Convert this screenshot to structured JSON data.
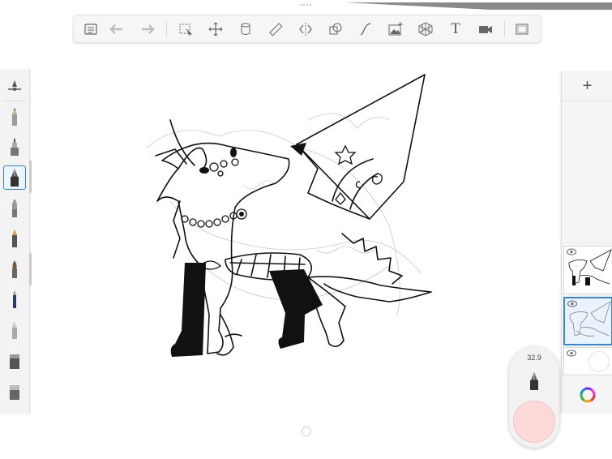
{
  "toolbar": {
    "tools": [
      {
        "name": "layers-list-icon"
      },
      {
        "name": "undo-icon"
      },
      {
        "name": "redo-icon"
      },
      {
        "name": "selection-icon"
      },
      {
        "name": "transform-icon"
      },
      {
        "name": "fill-icon"
      },
      {
        "name": "ruler-icon"
      },
      {
        "name": "symmetry-icon"
      },
      {
        "name": "shapes-icon"
      },
      {
        "name": "curve-icon"
      },
      {
        "name": "import-image-icon"
      },
      {
        "name": "perspective-icon"
      },
      {
        "name": "text-icon"
      },
      {
        "name": "record-icon"
      },
      {
        "name": "fullscreen-icon"
      }
    ],
    "text_tool_label": "T"
  },
  "brushes": [
    "brush-settings-icon",
    "pencil-icon",
    "airbrush-icon",
    "inking-pen-icon",
    "marker-icon",
    "fountain-pen-icon",
    "paintbrush-icon",
    "ballpoint-pen-icon",
    "chisel-icon",
    "smudge-icon",
    "eraser-icon"
  ],
  "selected_brush": "inking-pen-icon",
  "layers": {
    "add_label": "+",
    "items": [
      {
        "name": "layer-1",
        "visible": true,
        "active": false
      },
      {
        "name": "layer-2",
        "visible": true,
        "active": true
      },
      {
        "name": "background-layer",
        "visible": true,
        "active": false
      }
    ]
  },
  "puck": {
    "brush_size": "32.9",
    "current_color": "#fdd9d9"
  },
  "colors": {
    "accent": "#3a86d4",
    "ink": "#111111"
  }
}
